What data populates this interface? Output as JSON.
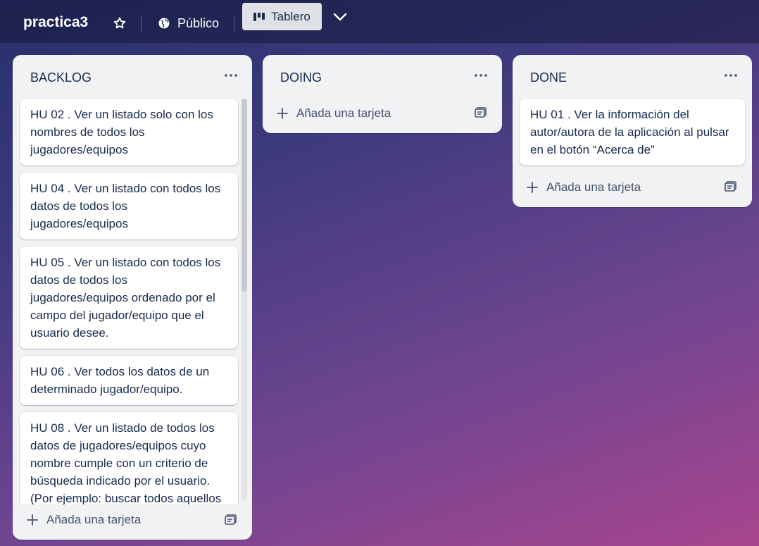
{
  "header": {
    "board_name": "practica3",
    "visibility_label": "Público",
    "view_label": "Tablero"
  },
  "lists": [
    {
      "title": "BACKLOG",
      "cards": [
        "HU 02 . Ver un listado solo con los nombres de todos los jugadores/equipos",
        "HU 04 . Ver un listado con todos los datos de todos los jugadores/equipos",
        "HU 05 . Ver un listado con todos los datos de todos los jugadores/equipos ordenado por el campo del jugador/equipo que el usuario desee.",
        "HU 06 . Ver todos los datos de un determinado jugador/equipo.",
        "HU 08 . Ver un listado de todos los datos de jugadores/equipos cuyo nombre cumple con un criterio de búsqueda indicado por el usuario. (Por ejemplo: buscar todos aquellos"
      ],
      "add_label": "Añada una tarjeta"
    },
    {
      "title": "DOING",
      "cards": [],
      "add_label": "Añada una tarjeta"
    },
    {
      "title": "DONE",
      "cards": [
        "HU 01 . Ver la información del autor/autora de la aplicación al pulsar en el botón “Acerca de”"
      ],
      "add_label": "Añada una tarjeta"
    }
  ],
  "icons": {
    "star": "star-icon",
    "globe": "globe-icon",
    "board": "board-icon",
    "chevron": "chevron-down-icon",
    "menu": "ellipsis-icon",
    "plus": "plus-icon",
    "template": "card-template-icon"
  },
  "colors": {
    "list_bg": "#f1f2f4",
    "card_text": "#172b4d",
    "view_button_bg": "#dfe1e6"
  }
}
